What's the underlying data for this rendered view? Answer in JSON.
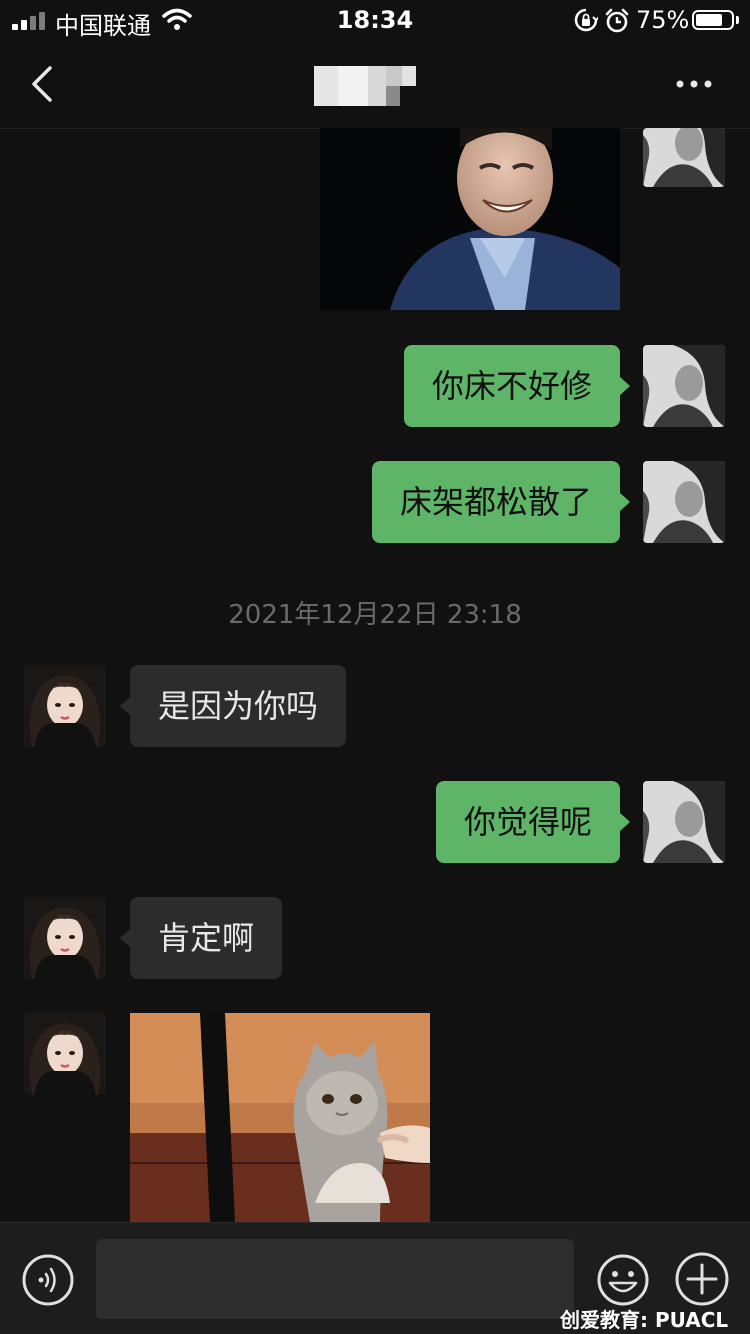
{
  "status_bar": {
    "carrier": "中国联通",
    "time": "18:34",
    "battery_percent": "75%",
    "battery_level": 0.75,
    "icons": [
      "signal-icon",
      "wifi-icon",
      "orientation-lock-icon",
      "alarm-icon",
      "battery-icon"
    ]
  },
  "nav": {
    "back_icon": "chevron-left-icon",
    "contact_name_blurred": true,
    "more_icon": "more-dots-icon"
  },
  "messages": [
    {
      "side": "mine",
      "type": "image",
      "content": "laughing man sticker"
    },
    {
      "side": "mine",
      "type": "text",
      "text": "你床不好修"
    },
    {
      "side": "mine",
      "type": "text",
      "text": "床架都松散了"
    },
    {
      "type": "timestamp",
      "text": "2021年12月22日 23:18"
    },
    {
      "side": "theirs",
      "type": "text",
      "text": "是因为你吗"
    },
    {
      "side": "mine",
      "type": "text",
      "text": "你觉得呢"
    },
    {
      "side": "theirs",
      "type": "text",
      "text": "肯定啊"
    },
    {
      "side": "theirs",
      "type": "image",
      "content": "grumpy cat sticker"
    }
  ],
  "input_bar": {
    "voice_icon": "voice-icon",
    "text_value": "",
    "emoji_icon": "emoji-icon",
    "plus_icon": "plus-icon"
  },
  "watermark": "创爱教育: PUACL",
  "colors": {
    "background": "#111111",
    "my_bubble": "#5fb567",
    "their_bubble": "#2c2c2c",
    "timestamp": "#6a6a6a",
    "input_bar": "#1d1d1d"
  }
}
